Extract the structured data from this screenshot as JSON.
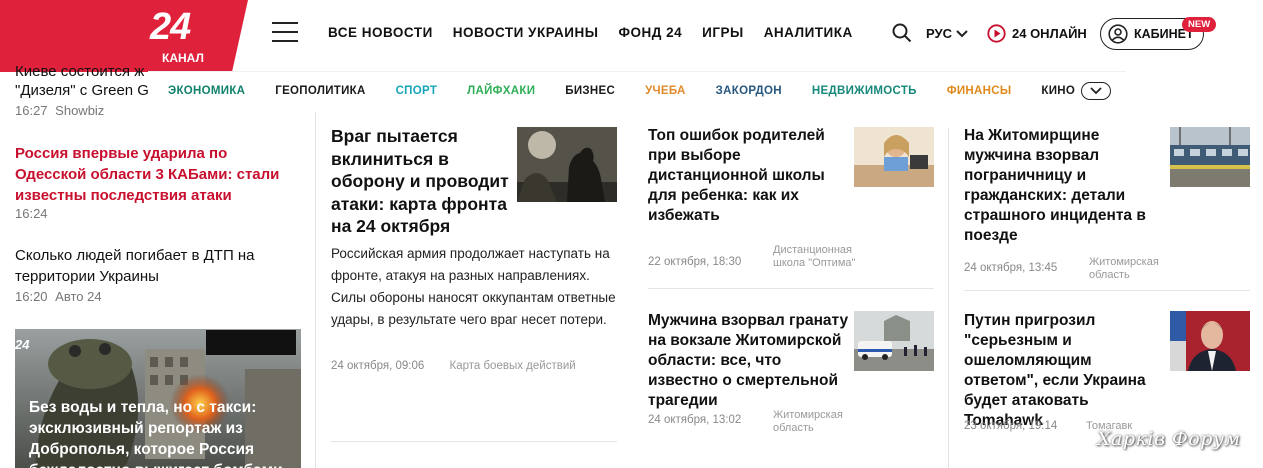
{
  "header": {
    "logo_number": "24",
    "logo_sub": "КАНАЛ",
    "nav": [
      "ВСЕ НОВОСТИ",
      "НОВОСТИ УКРАИНЫ",
      "ФОНД 24",
      "ИГРЫ",
      "АНАЛИТИКА"
    ],
    "lang": "РУС",
    "online": "24 ОНЛАЙН",
    "cabinet": "КАБИНЕТ",
    "new_badge": "NEW"
  },
  "categories": [
    {
      "label": "ЭКОНОМИКА",
      "color": "#11806a"
    },
    {
      "label": "ГЕОПОЛИТИКА",
      "color": "#1a1a1a"
    },
    {
      "label": "СПОРТ",
      "color": "#16a5b8"
    },
    {
      "label": "ЛАЙФХАКИ",
      "color": "#2eae56"
    },
    {
      "label": "БИЗНЕС",
      "color": "#1a1a1a"
    },
    {
      "label": "УЧЕБА",
      "color": "#e08a2a"
    },
    {
      "label": "ЗАКОРДОН",
      "color": "#27577f"
    },
    {
      "label": "НЕДВИЖИМОСТЬ",
      "color": "#16887a"
    },
    {
      "label": "ФИНАНСЫ",
      "color": "#e0891b"
    },
    {
      "label": "КИНО",
      "color": "#1a1a1a"
    }
  ],
  "left": {
    "clipped_line1": "Киеве состоится ж",
    "clipped_line2": "\"Дизеля\" с Green G",
    "item0_time": "16:27",
    "item0_tag": "Showbiz",
    "item1_title": "Россия впервые ударила по Одесской области 3 КАБами: стали известны последствия атаки",
    "item1_time": "16:24",
    "item2_title": "Сколько людей погибает в ДТП на территории Украины",
    "item2_time": "16:20",
    "item2_tag": "Авто 24",
    "photo_title": "Без воды и тепла, но с такси: эксклюзивный репортаж из Доброполья, которое Россия беждалостно выжигает бомбами"
  },
  "main": {
    "title": "Враг пытается вклиниться в оборону и проводит атаки: карта фронта на 24 октября",
    "lead": "Российская армия продолжает наступать на фронте, атакуя на разных направлениях. Силы обороны наносят оккупантам ответные удары, в результате чего враг несет потери.",
    "date": "24 октября, 09:06",
    "source": "Карта боевых действий"
  },
  "cards": [
    {
      "title": "Топ ошибок родителей при выборе дистанционной школы для ребенка: как их избежать",
      "date": "22 октября, 18:30",
      "source": "Дистанционная школа \"Оптима\""
    },
    {
      "title": "На Житомирщине мужчина взорвал пограничницу и гражданских: детали страшного инцидента в поезде",
      "date": "24 октября, 13:45",
      "source": "Житомирская область"
    },
    {
      "title": "Мужчина взорвал гранату на вокзале Житомирской области: все, что известно о смертельной трагедии",
      "date": "24 октября, 13:02",
      "source": "Житомирская область"
    },
    {
      "title": "Путин пригрозил \"серьезным и ошеломляющим ответом\", если Украина будет атаковать Tomahawk",
      "date": "23 октября, 19:14",
      "source": "Томагавк"
    }
  ],
  "watermark": "Харків Форум"
}
